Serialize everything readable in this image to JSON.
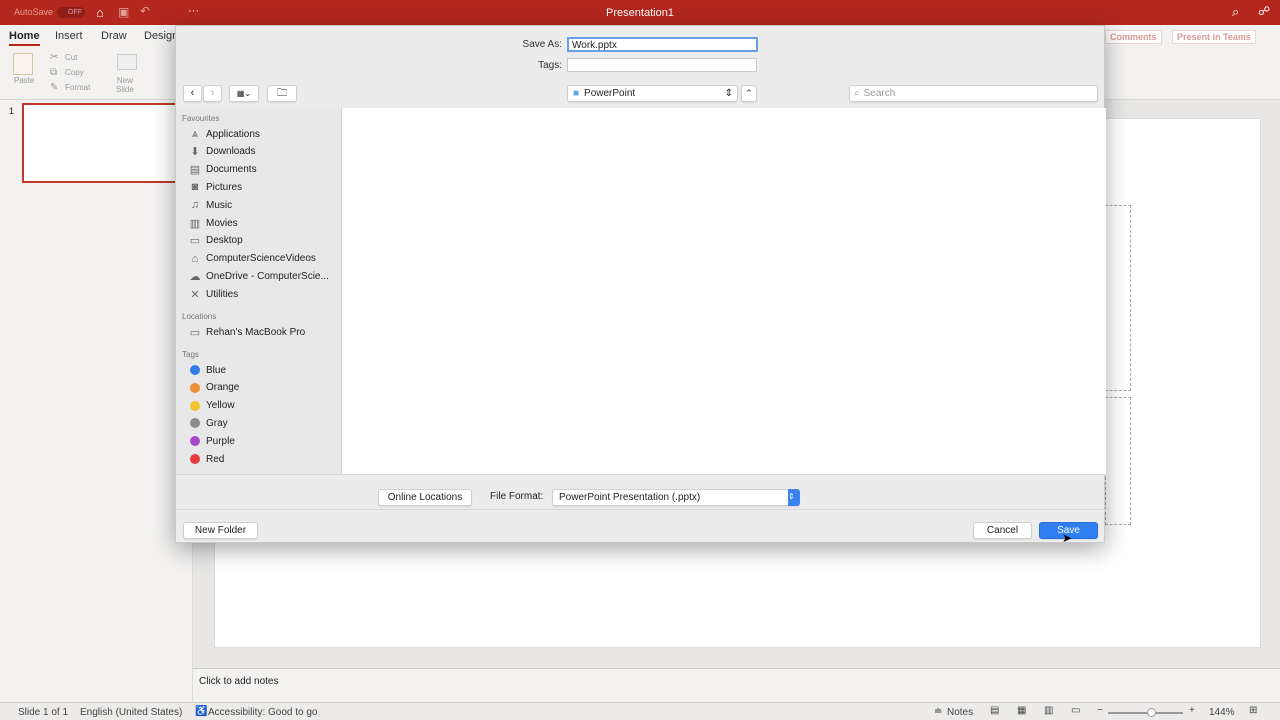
{
  "titlebar": {
    "autosave": "AutoSave",
    "toggle": "OFF",
    "title": "Presentation1",
    "more": "···"
  },
  "ribbon": {
    "tabs": [
      "Home",
      "Insert",
      "Draw",
      "Design"
    ],
    "paste": "Paste",
    "cut": "Cut",
    "copy": "Copy",
    "format": "Format",
    "new_slide": "New\nSlide",
    "comments": "Comments",
    "present": "Present in Teams"
  },
  "thumbs": {
    "slide_number": "1"
  },
  "notes": {
    "placeholder": "Click to add notes"
  },
  "status": {
    "slide": "Slide 1 of 1",
    "language": "English (United States)",
    "accessibility": "Accessibility: Good to go",
    "notes": "Notes",
    "zoom": "144%",
    "zoom_level_percent": 144
  },
  "dialog": {
    "save_as_label": "Save As:",
    "save_as_value": "Work.pptx",
    "tags_label": "Tags:",
    "tags_value": "",
    "location": "PowerPoint",
    "search_placeholder": "Search",
    "sidebar": {
      "favourites_header": "Favourites",
      "favourites": [
        {
          "label": "Applications",
          "icon": "applications-icon"
        },
        {
          "label": "Downloads",
          "icon": "downloads-icon"
        },
        {
          "label": "Documents",
          "icon": "documents-icon"
        },
        {
          "label": "Pictures",
          "icon": "pictures-icon"
        },
        {
          "label": "Music",
          "icon": "music-icon"
        },
        {
          "label": "Movies",
          "icon": "movies-icon"
        },
        {
          "label": "Desktop",
          "icon": "desktop-icon"
        },
        {
          "label": "ComputerScienceVideos",
          "icon": "home-icon"
        },
        {
          "label": "OneDrive - ComputerScie...",
          "icon": "cloud-icon"
        },
        {
          "label": "Utilities",
          "icon": "utilities-icon"
        }
      ],
      "locations_header": "Locations",
      "locations": [
        {
          "label": "Rehan's MacBook Pro",
          "icon": "laptop-icon"
        }
      ],
      "tags_header": "Tags",
      "tags": [
        {
          "label": "Blue",
          "color": "#2f7be8"
        },
        {
          "label": "Orange",
          "color": "#ef8a35"
        },
        {
          "label": "Yellow",
          "color": "#f2c530"
        },
        {
          "label": "Gray",
          "color": "#8c8c8c"
        },
        {
          "label": "Purple",
          "color": "#a448cc"
        },
        {
          "label": "Red",
          "color": "#e43b3b"
        }
      ]
    },
    "online_locations": "Online Locations",
    "file_format_label": "File Format:",
    "file_format_value": "PowerPoint Presentation (.pptx)",
    "new_folder": "New Folder",
    "cancel": "Cancel",
    "save": "Save"
  }
}
